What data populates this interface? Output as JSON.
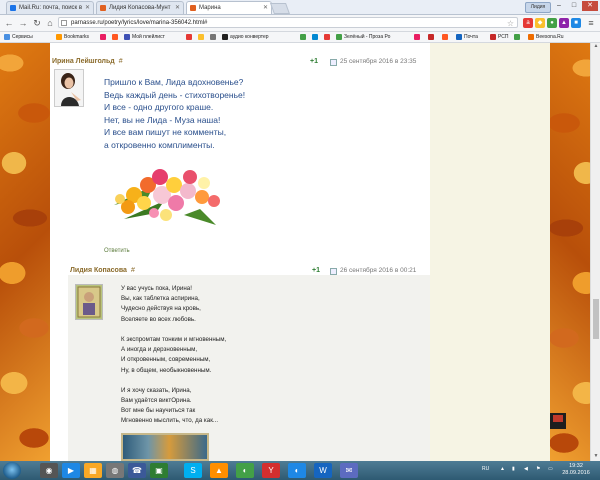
{
  "browser": {
    "tabs": [
      {
        "label": "Mail.Ru: почта, поиск в",
        "color": "#1a73e8"
      },
      {
        "label": "Лидия Копасова-Мунт",
        "color": "#e06020"
      },
      {
        "label": "Марина",
        "color": "#e06020"
      }
    ],
    "user_chip": "Лидия",
    "window_buttons": {
      "min": "–",
      "max": "□",
      "close": "✕"
    },
    "url": "parnasse.ru/poetry/lyrics/love/marina-356042.html#",
    "bookmarks": [
      {
        "label": "Сервисы",
        "color": "#4a90e2"
      },
      {
        "label": "Bookmarks",
        "color": "#ff9800"
      },
      {
        "label": "",
        "color": "#e91e63"
      },
      {
        "label": "",
        "color": "#ff5722"
      },
      {
        "label": "Мой плейлист",
        "color": "#3f51b5"
      },
      {
        "label": "",
        "color": "#e53935"
      },
      {
        "label": "",
        "color": "#fbc02d"
      },
      {
        "label": "",
        "color": "#757575"
      },
      {
        "label": "аудио конвертер",
        "color": "#212121"
      },
      {
        "label": "",
        "color": "#43a047"
      },
      {
        "label": "",
        "color": "#0288d1"
      },
      {
        "label": "",
        "color": "#e53935"
      },
      {
        "label": "Зелёный - Проза Ро",
        "color": "#43a047"
      },
      {
        "label": "",
        "color": "#e91e63"
      },
      {
        "label": "",
        "color": "#c62828"
      },
      {
        "label": "",
        "color": "#ff5722"
      },
      {
        "label": "Почта",
        "color": "#1565c0"
      },
      {
        "label": "РСП",
        "color": "#c62828"
      },
      {
        "label": "",
        "color": "#43a047"
      },
      {
        "label": "Beesona.Ru",
        "color": "#ef6c00"
      }
    ]
  },
  "comment1": {
    "author": "Ирина Лейшгольд",
    "hash": "#",
    "vote": "+1",
    "date": "25 сентября 2016 в 23:35",
    "lines": [
      "Пришло к Вам, Лида вдохновенье?",
      "Ведь каждый день - стихотворенье!",
      "И все - одно другого краше.",
      "Нет, вы не Лида - Муза наша!",
      "И все вам пишут не комменты,",
      "а откровенно комплименты."
    ],
    "reply": "Ответить"
  },
  "comment2": {
    "author": "Лидия Копасова",
    "hash": "#",
    "vote": "+1",
    "date": "26 сентября 2016 в 00:21",
    "lines": [
      "У вас учусь пока, Ирина!",
      "Вы, как таблетка аспирина,",
      "Чудесно действуя на кровь,",
      "Вселяете во всех любовь.",
      "",
      "К экспромтам тонким и мгновенным,",
      "А иногда и дерзновенным,",
      "И откровенным, современным,",
      "Ну, в общем, необыкновенным.",
      "",
      "И я хочу сказать, Ирина,",
      "Вам удаётся виктОрина.",
      "Вот мне бы научиться так",
      "Мгновенно мыслить, что, да как..."
    ]
  },
  "taskbar": {
    "lang": "RU",
    "time": "19:32",
    "date": "28.09.2016",
    "apps": [
      {
        "glyph": "◉",
        "color": "#444"
      },
      {
        "glyph": "▶",
        "color": "#1e88e5"
      },
      {
        "glyph": "▦",
        "color": "#f9a825"
      },
      {
        "glyph": "◍",
        "color": "#777"
      },
      {
        "glyph": "☎",
        "color": "#3b5998"
      },
      {
        "glyph": "▣",
        "color": "#2e7d32"
      },
      {
        "glyph": "S",
        "color": "#00aff0"
      },
      {
        "glyph": "▲",
        "color": "#ff8f00"
      },
      {
        "glyph": "◐",
        "color": "#43a047"
      },
      {
        "glyph": "Y",
        "color": "#d32f2f"
      },
      {
        "glyph": "◐",
        "color": "#1e88e5"
      },
      {
        "glyph": "W",
        "color": "#1565c0"
      },
      {
        "glyph": "✉",
        "color": "#5c6bc0"
      }
    ]
  }
}
